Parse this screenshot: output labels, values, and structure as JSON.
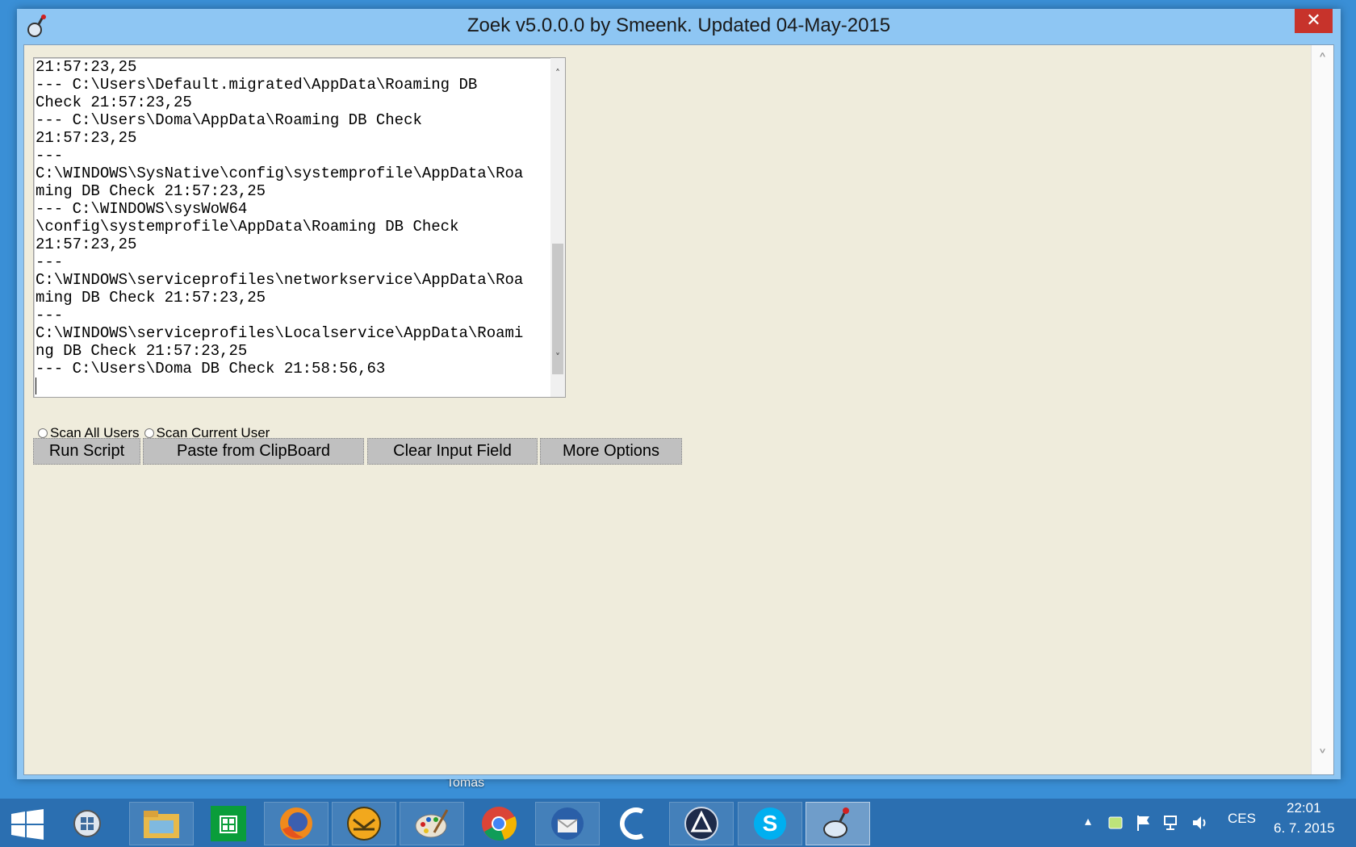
{
  "window": {
    "title": "Zoek v5.0.0.0 by Smeenk. Updated 04-May-2015",
    "close_glyph": "✕"
  },
  "log": {
    "lines": [
      "21:57:23,25",
      "--- C:\\Users\\Default.migrated\\AppData\\Roaming DB",
      "Check 21:57:23,25",
      "--- C:\\Users\\Doma\\AppData\\Roaming DB Check",
      "21:57:23,25",
      "---",
      "C:\\WINDOWS\\SysNative\\config\\systemprofile\\AppData\\Roa",
      "ming DB Check 21:57:23,25",
      "--- C:\\WINDOWS\\sysWoW64",
      "\\config\\systemprofile\\AppData\\Roaming DB Check",
      "21:57:23,25",
      "---",
      "C:\\WINDOWS\\serviceprofiles\\networkservice\\AppData\\Roa",
      "ming DB Check 21:57:23,25",
      "---",
      "C:\\WINDOWS\\serviceprofiles\\Localservice\\AppData\\Roami",
      "ng DB Check 21:57:23,25",
      "--- C:\\Users\\Doma DB Check 21:58:56,63"
    ]
  },
  "options": {
    "scan_all_users": "Scan All Users",
    "scan_current_user": "Scan Current User"
  },
  "buttons": {
    "run_script": "Run Script",
    "paste_clipboard": "Paste from ClipBoard",
    "clear_input": "Clear Input Field",
    "more_options": "More Options"
  },
  "desktop": {
    "label_fragment": "Tomas"
  },
  "taskbar": {
    "language": "CES",
    "time": "22:01",
    "date": "6. 7. 2015",
    "items": [
      "file-explorer",
      "store",
      "firefox",
      "mail",
      "paint",
      "chrome",
      "thunderbird",
      "ccleaner",
      "avira",
      "skype",
      "zoek"
    ]
  },
  "colors": {
    "titlebar": "#8ec6f3",
    "close_button": "#c7332b",
    "client_bg": "#efecdc",
    "button_bg": "#c0c0c0",
    "taskbar": "#2b6fb1"
  }
}
